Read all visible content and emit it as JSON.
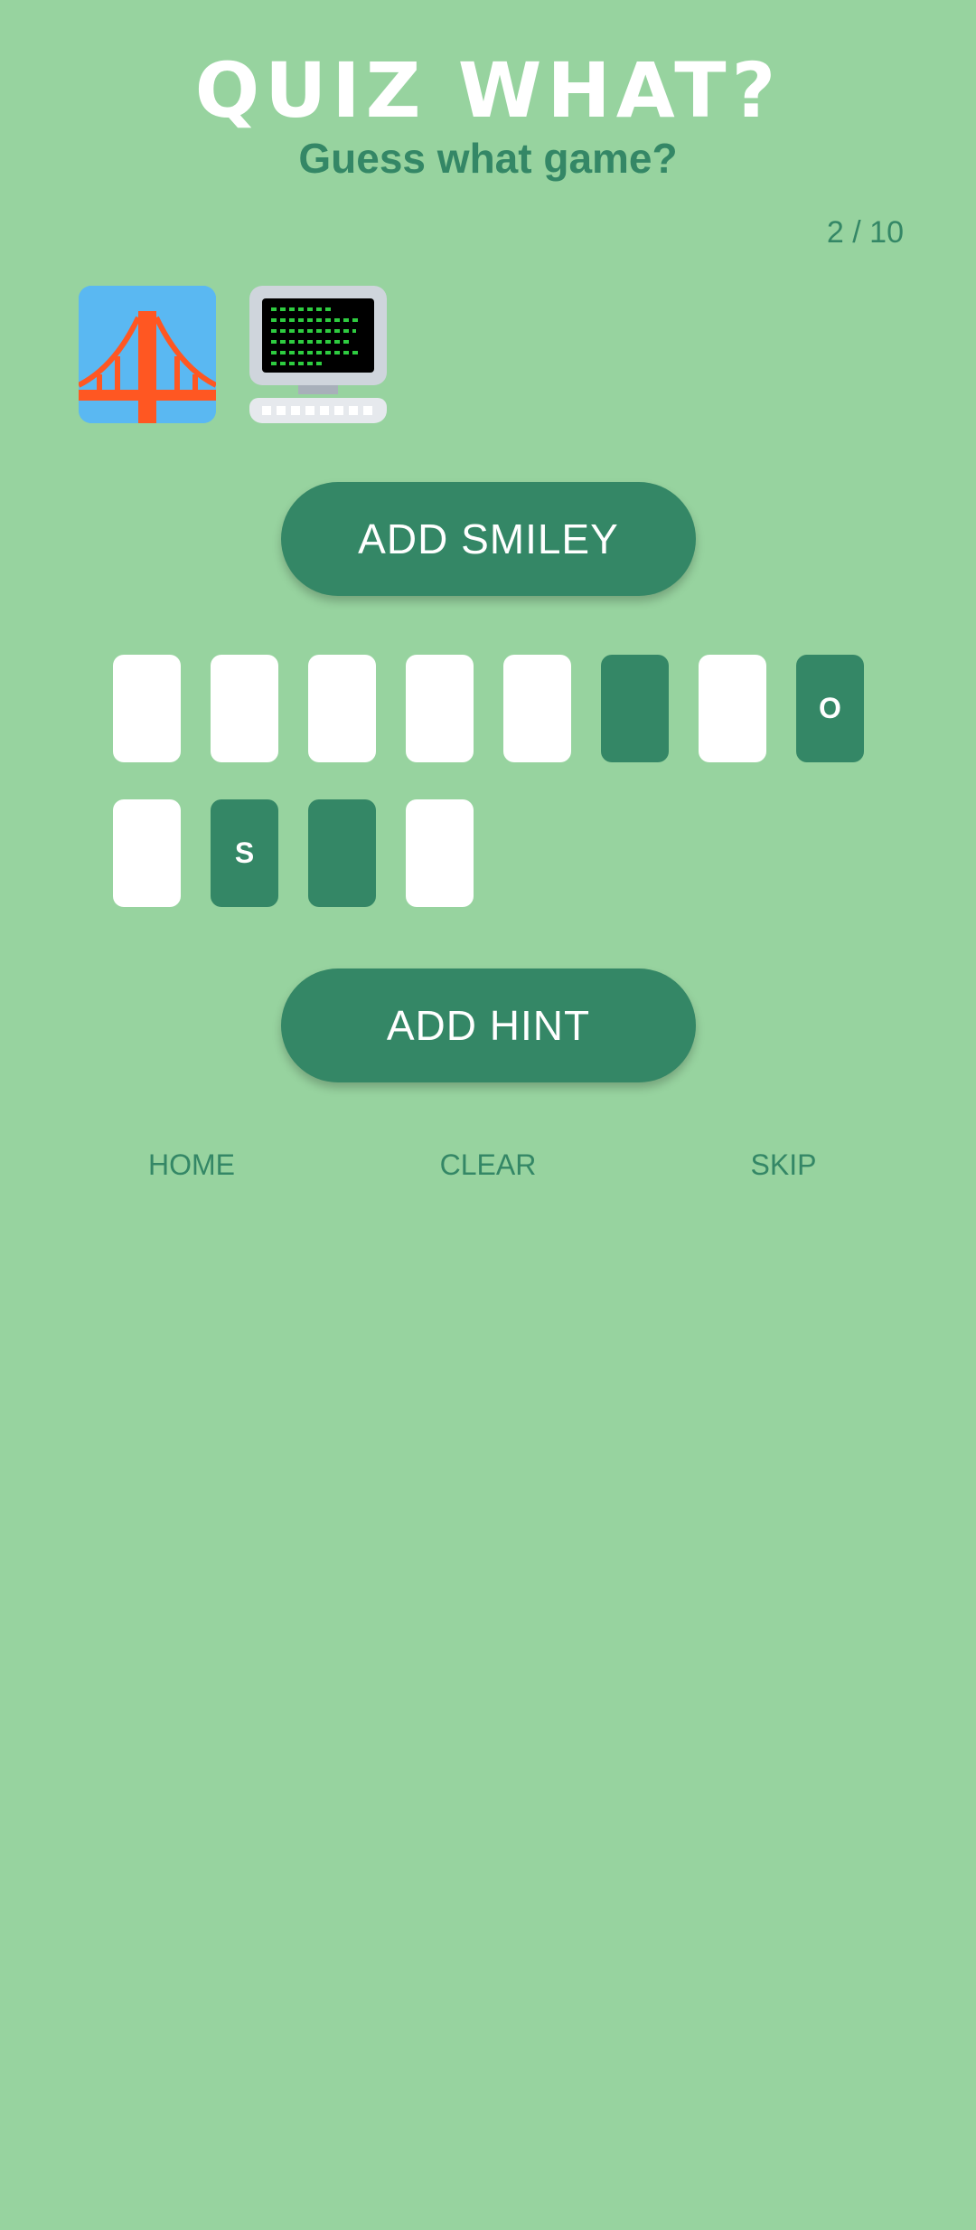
{
  "header": {
    "title": "QUIZ WHAT?",
    "subtitle": "Guess what game?",
    "counter": "2 / 10"
  },
  "clues": [
    {
      "icon": "bridge-icon"
    },
    {
      "icon": "computer-icon"
    }
  ],
  "buttons": {
    "add_smiley": "ADD SMILEY",
    "add_hint": "ADD HINT"
  },
  "answer_slots": [
    {
      "letter": "",
      "revealed": false
    },
    {
      "letter": "",
      "revealed": false
    },
    {
      "letter": "",
      "revealed": false
    },
    {
      "letter": "",
      "revealed": false
    },
    {
      "letter": "",
      "revealed": false
    },
    {
      "letter": "",
      "revealed": true
    },
    {
      "letter": "",
      "revealed": false
    },
    {
      "letter": "O",
      "revealed": true
    },
    {
      "letter": "",
      "revealed": false
    },
    {
      "letter": "S",
      "revealed": true
    },
    {
      "letter": "",
      "revealed": true
    },
    {
      "letter": "",
      "revealed": false
    }
  ],
  "nav": {
    "home": "HOME",
    "clear": "CLEAR",
    "skip": "SKIP"
  },
  "colors": {
    "background": "#97d39f",
    "accent": "#348766",
    "tile": "#ffffff"
  }
}
